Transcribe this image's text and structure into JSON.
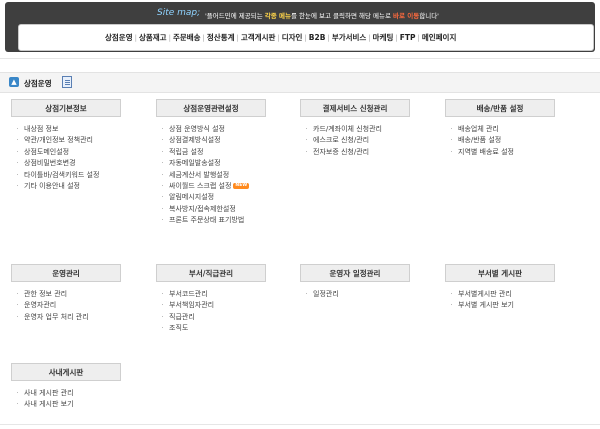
{
  "site_map": {
    "title": "Site map;",
    "desc_pre": "'플어드민에 제공되는 ",
    "desc_highlight": "각종 메뉴",
    "desc_mid": "를 한눈에 보고 클릭하면 해당 메뉴로 ",
    "desc_link": "바로 이동",
    "desc_post": "합니다'",
    "menu": [
      "상점운영",
      "상품재고",
      "주문배송",
      "정산통계",
      "고객게시판",
      "디자인",
      "B2B",
      "부가서비스",
      "마케팅",
      "FTP",
      "메인페이지"
    ]
  },
  "section": {
    "title": "상점운영"
  },
  "badges": {
    "new": "NEW"
  },
  "groups": [
    {
      "title": "상점기본정보",
      "items": [
        "내상점 정보",
        "약관/개인정보 정책관리",
        "상점도메인설정",
        "상점비밀번호변경",
        "타이틀바/검색키워드 설정",
        "기타 이용안내 설정"
      ]
    },
    {
      "title": "상점운영관련설정",
      "items": [
        "상점 운영방식 설정",
        "상점결제방식설정",
        "적립금 설정",
        "자동메일발송설정",
        "세금계산서 발행설정",
        "싸이월드 스크랩 설정",
        "알림메시지설정",
        "복사방지/접속제한설정",
        "프론트 주문상태 표기방법"
      ]
    },
    {
      "title": "결제서비스 신청관리",
      "items": [
        "카드/계좌이체 신청관리",
        "에스크로 신청/관리",
        "전자보증 신청/관리"
      ]
    },
    {
      "title": "배송/반품 설정",
      "items": [
        "배송업체 관리",
        "배송/반품 설정",
        "지역별 배송료 설정"
      ]
    },
    {
      "title": "운영관리",
      "items": [
        "관한 정보 관리",
        "운영자관리",
        "운영자 업무 처리 관리"
      ]
    },
    {
      "title": "부서/직급관리",
      "items": [
        "부서코드관리",
        "부서책임자관리",
        "직급관리",
        "조직도"
      ]
    },
    {
      "title": "운영자 일정관리",
      "items": [
        "일정관리"
      ]
    },
    {
      "title": "부서별 게시판",
      "items": [
        "부서별게시판 관리",
        "부서별 게시판 보기"
      ]
    },
    {
      "title": "사내게시판",
      "items": [
        "사내 게시판 관리",
        "사내 게시판 보기"
      ]
    }
  ]
}
